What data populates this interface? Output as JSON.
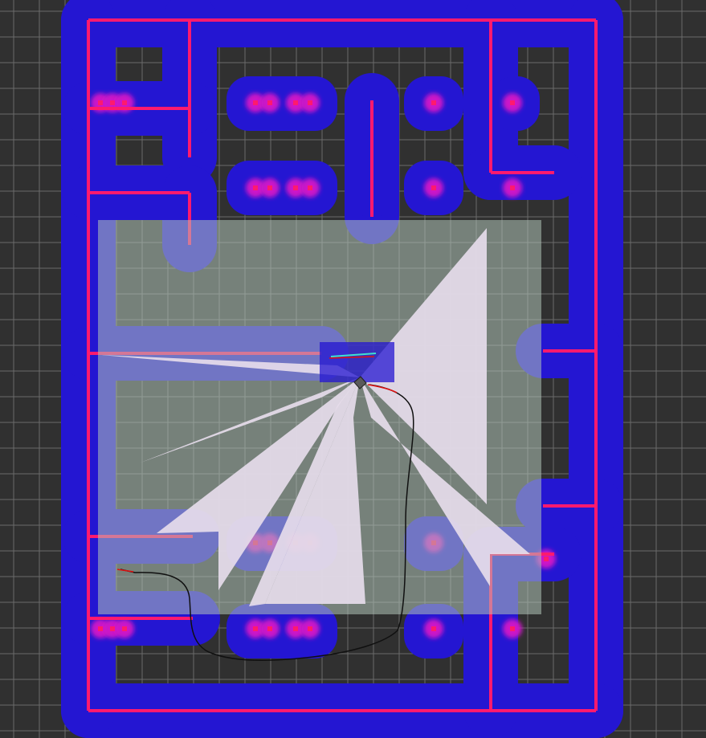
{
  "viewer": {
    "background_color": "#303030",
    "grid_color": "#6a6a6a"
  },
  "global_costmap": {
    "lethal_color": "#ff1a6e",
    "inflation_color": "#2416d2",
    "inflation_glow_color": "#cc14c8"
  },
  "local_costmap": {
    "overlay_color": "#b0c4b8",
    "free_cone_color": "#e6dcea"
  },
  "robot": {
    "footprint_color": "#5a5a5a",
    "path_color": "#101010",
    "local_plan_color": "#e01010",
    "laser_color": "#40e0d0"
  }
}
